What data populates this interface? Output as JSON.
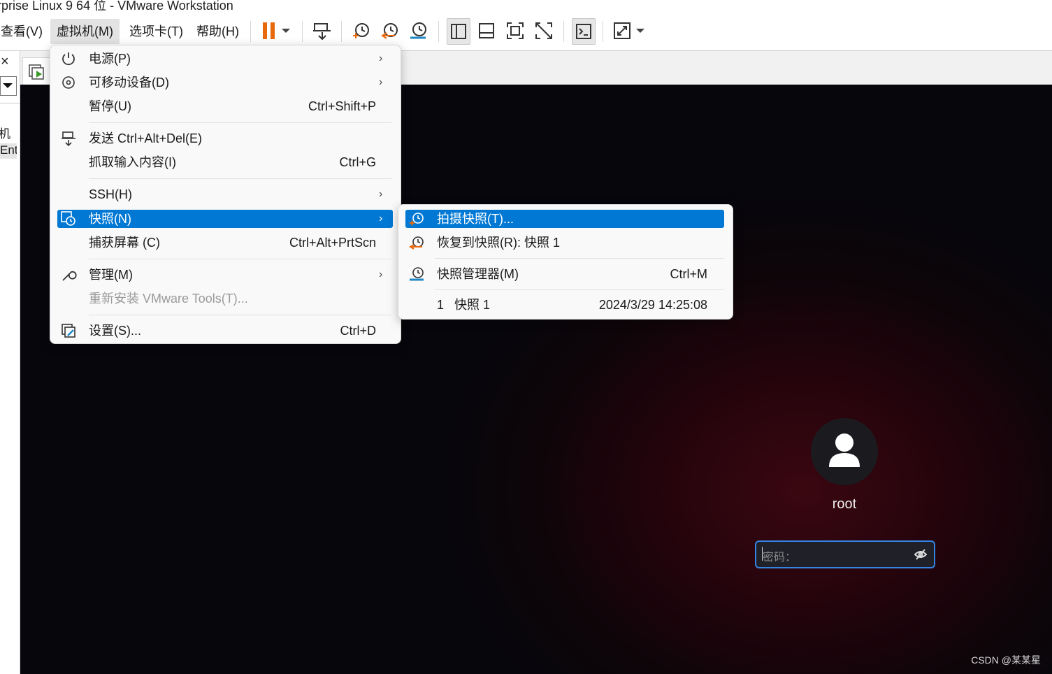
{
  "window": {
    "title": "rprise Linux 9 64 位 - VMware Workstation"
  },
  "menubar": {
    "items": [
      "查看(V)",
      "虚拟机(M)",
      "选项卡(T)",
      "帮助(H)"
    ]
  },
  "toolbar": {
    "icons": [
      "pause-icon",
      "dropdown-arrow-icon",
      "send-ctrl-alt-del-icon",
      "take-snapshot-icon",
      "revert-snapshot-icon",
      "snapshot-manager-icon",
      "library-view-icon",
      "thumbnail-view-icon",
      "fullscreen-icon",
      "unity-icon",
      "console-icon",
      "stretch-icon",
      "dropdown-arrow-icon"
    ]
  },
  "leftpane": {
    "close_glyph": "×",
    "text1": "机",
    "text2": "Ent"
  },
  "vm_menu": {
    "items": [
      {
        "label": "电源(P)",
        "shortcut": "",
        "submenu": true,
        "icon": "power-icon"
      },
      {
        "label": "可移动设备(D)",
        "shortcut": "",
        "submenu": true,
        "icon": "removable-device-icon"
      },
      {
        "label": "暂停(U)",
        "shortcut": "Ctrl+Shift+P",
        "submenu": false,
        "icon": ""
      },
      {
        "label": "发送 Ctrl+Alt+Del(E)",
        "shortcut": "",
        "submenu": false,
        "icon": "send-keys-icon"
      },
      {
        "label": "抓取输入内容(I)",
        "shortcut": "Ctrl+G",
        "submenu": false,
        "icon": ""
      },
      {
        "label": "SSH(H)",
        "shortcut": "",
        "submenu": true,
        "icon": ""
      },
      {
        "label": "快照(N)",
        "shortcut": "",
        "submenu": true,
        "icon": "snapshot-icon",
        "highlighted": true
      },
      {
        "label": "捕获屏幕 (C)",
        "shortcut": "Ctrl+Alt+PrtScn",
        "submenu": false,
        "icon": ""
      },
      {
        "label": "管理(M)",
        "shortcut": "",
        "submenu": true,
        "icon": "wrench-icon"
      },
      {
        "label": "重新安装 VMware Tools(T)...",
        "shortcut": "",
        "submenu": false,
        "icon": "",
        "disabled": true
      },
      {
        "label": "设置(S)...",
        "shortcut": "Ctrl+D",
        "submenu": false,
        "icon": "settings-icon"
      }
    ],
    "submenu_glyph": "›"
  },
  "snapshot_menu": {
    "take": "拍摄快照(T)...",
    "revert": "恢复到快照(R): 快照 1",
    "manager": "快照管理器(M)",
    "manager_shortcut": "Ctrl+M",
    "entry_index": "1",
    "entry_name": "快照 1",
    "entry_time": "2024/3/29 14:25:08"
  },
  "login": {
    "username": "root",
    "password_placeholder": "密码："
  },
  "watermark": "CSDN @某某星",
  "colors": {
    "highlight": "#0078d4",
    "focus_ring": "#3584e4",
    "pause_orange": "#e8690c"
  }
}
